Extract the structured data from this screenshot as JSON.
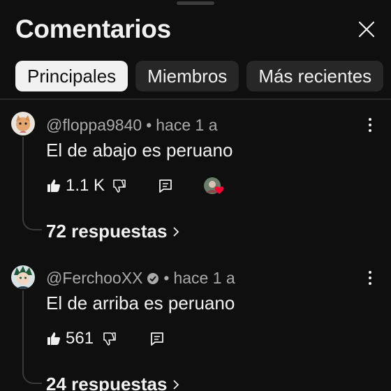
{
  "header": {
    "title": "Comentarios"
  },
  "tabs": [
    {
      "label": "Principales",
      "active": true
    },
    {
      "label": "Miembros",
      "active": false
    },
    {
      "label": "Más recientes",
      "active": false
    }
  ],
  "comments": [
    {
      "author": "@floppa9840",
      "verified": false,
      "time": "hace 1 a",
      "text": "El de abajo es peruano",
      "likes": "1.1 K",
      "creator_heart": true,
      "replies": "72 respuestas"
    },
    {
      "author": "@FerchooXX",
      "verified": true,
      "time": "hace 1 a",
      "text": "El de arriba es peruano",
      "likes": "561",
      "creator_heart": false,
      "replies": "24 respuestas"
    }
  ],
  "separator": "•",
  "colors": {
    "background": "#0f0f0f",
    "chip": "#272727",
    "chip_active": "#f1f1f1",
    "secondary_text": "#aaaaaa",
    "heart": "#ff0033"
  },
  "icons": [
    "close-icon",
    "like-icon",
    "dislike-icon",
    "reply-icon",
    "more-vert-icon",
    "verified-icon",
    "chevron-right-icon",
    "heart-icon"
  ]
}
